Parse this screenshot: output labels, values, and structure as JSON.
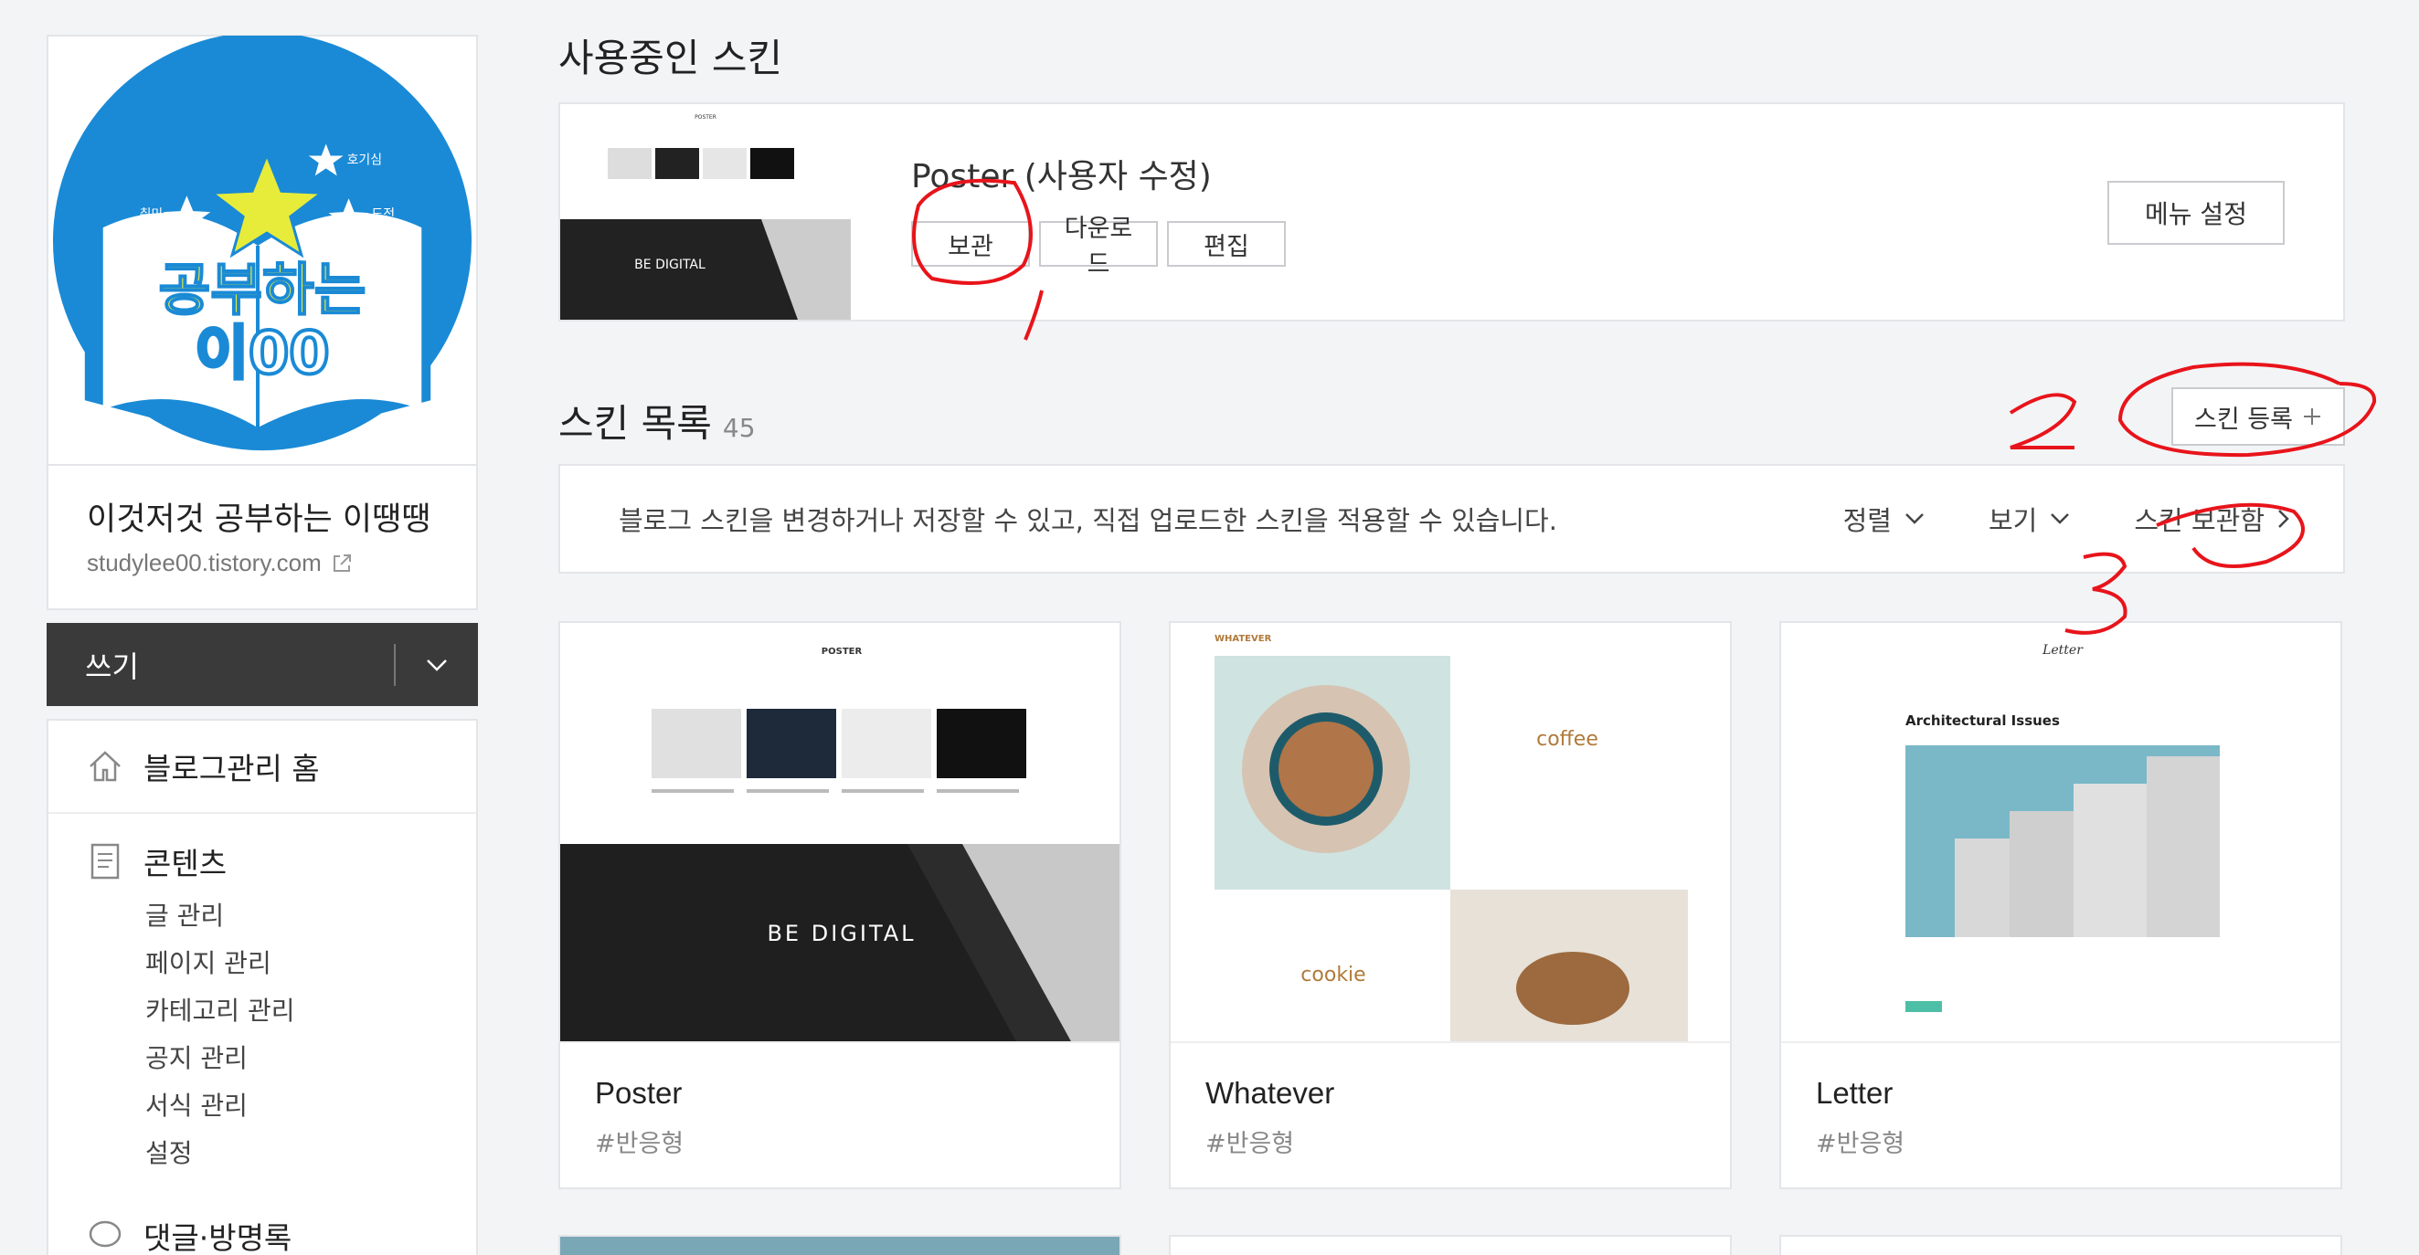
{
  "sidebar": {
    "blog_name": "이것저것 공부하는 이땡땡",
    "blog_url": "studylee00.tistory.com",
    "logo": {
      "line1": "공부하는",
      "line2": "이00",
      "badges": [
        "호기심",
        "취미",
        "도전"
      ]
    },
    "write_label": "쓰기",
    "home_label": "블로그관리 홈",
    "contents_label": "콘텐츠",
    "contents_items": [
      "글 관리",
      "페이지 관리",
      "카테고리 관리",
      "공지 관리",
      "서식 관리",
      "설정"
    ],
    "next_section_label": "댓글·방명록"
  },
  "current": {
    "heading": "사용중인 스킨",
    "skin_name": "Poster (사용자 수정)",
    "buttons": {
      "archive": "보관",
      "download": "다운로드",
      "edit": "편집"
    },
    "menu_setting": "메뉴 설정"
  },
  "list": {
    "heading": "스킨 목록",
    "count": "45",
    "register_label": "스킨 등록",
    "info_text": "블로그 스킨을 변경하거나 저장할 수 있고, 직접 업로드한 스킨을 적용할 수 있습니다.",
    "sort_label": "정렬",
    "view_label": "보기",
    "archive_label": "스킨 보관함",
    "cards": [
      {
        "name": "Poster",
        "tag": "#반응형"
      },
      {
        "name": "Whatever",
        "tag": "#반응형"
      },
      {
        "name": "Letter",
        "tag": "#반응형"
      }
    ]
  },
  "thumbs": {
    "poster_header": "POSTER",
    "poster_hero": "BE DIGITAL",
    "whatever_brand": "WHATEVER",
    "whatever_coffee": "coffee",
    "whatever_cookie": "cookie",
    "letter_brand": "Letter",
    "letter_article": "Architectural Issues"
  },
  "annotations": [
    "1",
    "2",
    "3"
  ],
  "colors": {
    "accent_red": "#e8141b",
    "logo_blue": "#1a8ad6",
    "logo_yellow": "#e7ec3a",
    "write_bg": "#3a3a3a"
  }
}
